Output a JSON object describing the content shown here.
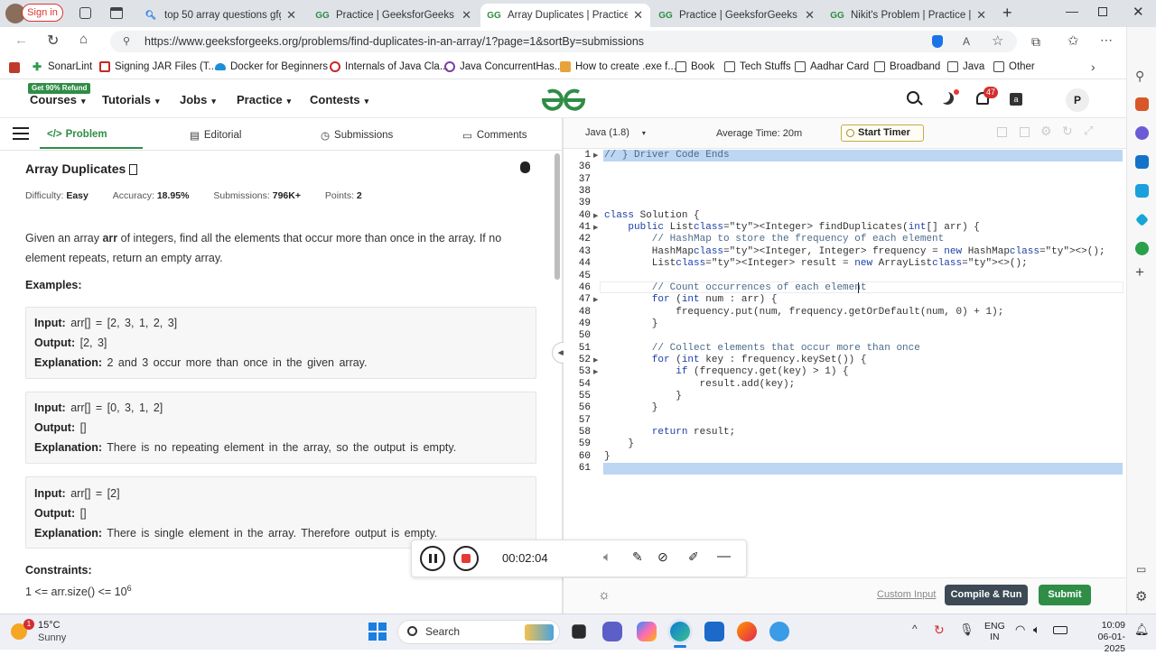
{
  "browser": {
    "profile_button": "Sign in",
    "tabs": [
      {
        "title": "top 50 array questions gfg - Se",
        "active": false
      },
      {
        "title": "Practice | GeeksforGeeks | A co",
        "active": false
      },
      {
        "title": "Array Duplicates | Practice | Ge",
        "active": true
      },
      {
        "title": "Practice | GeeksforGeeks | A co",
        "active": false
      },
      {
        "title": "Nikit's Problem | Practice | Gee",
        "active": false
      }
    ],
    "url": "https://www.geeksforgeeks.org/problems/find-duplicates-in-an-array/1?page=1&sortBy=submissions",
    "bookmarks": [
      "SonarLint",
      "Signing JAR Files (T...",
      "Docker for Beginners",
      "Internals of Java Cla...",
      "Java ConcurrentHas...",
      "How to create .exe f...",
      "Book",
      "Tech Stuffs",
      "Aadhar Card",
      "Broadband",
      "Java",
      "Other"
    ]
  },
  "header": {
    "refund_badge": "Get 90% Refund",
    "nav": [
      "Courses",
      "Tutorials",
      "Jobs",
      "Practice",
      "Contests"
    ],
    "notification_count": "47",
    "avatar_letter": "P"
  },
  "problem_tabs": [
    "Problem",
    "Editorial",
    "Submissions",
    "Comments"
  ],
  "problem": {
    "title": "Array Duplicates",
    "difficulty_label": "Difficulty:",
    "difficulty": "Easy",
    "accuracy_label": "Accuracy:",
    "accuracy": "18.95%",
    "submissions_label": "Submissions:",
    "submissions": "796K+",
    "points_label": "Points:",
    "points": "2",
    "desc_1a": "Given an array ",
    "desc_1b": "arr",
    "desc_1c": " of integers, find all the elements that occur more than once in the array. If no",
    "desc_2": "element repeats, return an empty array.",
    "examples_heading": "Examples:",
    "examples": [
      {
        "input": "arr[] = [2, 3, 1, 2, 3]",
        "output": "[2, 3]",
        "explanation": "2 and 3 occur more than once in the given array."
      },
      {
        "input": "arr[] = [0, 3, 1, 2]",
        "output": "[]",
        "explanation": "There is no repeating element in the array, so the output is empty."
      },
      {
        "input": "arr[] = [2]",
        "output": "[]",
        "explanation": "There is single element in the array. Therefore output is empty."
      }
    ],
    "input_label": "Input:",
    "output_label": "Output:",
    "explanation_label": "Explanation:",
    "constraints_heading": "Constraints:",
    "constraint_1": "1 <= arr.size() <= 10",
    "constraint_1_exp": "6"
  },
  "editor": {
    "language": "Java (1.8)",
    "avg_time": "Average Time: 20m",
    "timer_button": "Start Timer",
    "lines": [
      {
        "n": "1",
        "text": "// } Driver Code Ends"
      },
      {
        "n": "36",
        "text": ""
      },
      {
        "n": "37",
        "text": ""
      },
      {
        "n": "38",
        "text": ""
      },
      {
        "n": "39",
        "text": ""
      },
      {
        "n": "40",
        "text": "class Solution {"
      },
      {
        "n": "41",
        "text": "    public List<Integer> findDuplicates(int[] arr) {"
      },
      {
        "n": "42",
        "text": "        // HashMap to store the frequency of each element"
      },
      {
        "n": "43",
        "text": "        HashMap<Integer, Integer> frequency = new HashMap<>();"
      },
      {
        "n": "44",
        "text": "        List<Integer> result = new ArrayList<>();"
      },
      {
        "n": "45",
        "text": ""
      },
      {
        "n": "46",
        "text": "        // Count occurrences of each element"
      },
      {
        "n": "47",
        "text": "        for (int num : arr) {"
      },
      {
        "n": "48",
        "text": "            frequency.put(num, frequency.getOrDefault(num, 0) + 1);"
      },
      {
        "n": "49",
        "text": "        }"
      },
      {
        "n": "50",
        "text": ""
      },
      {
        "n": "51",
        "text": "        // Collect elements that occur more than once"
      },
      {
        "n": "52",
        "text": "        for (int key : frequency.keySet()) {"
      },
      {
        "n": "53",
        "text": "            if (frequency.get(key) > 1) {"
      },
      {
        "n": "54",
        "text": "                result.add(key);"
      },
      {
        "n": "55",
        "text": "            }"
      },
      {
        "n": "56",
        "text": "        }"
      },
      {
        "n": "57",
        "text": ""
      },
      {
        "n": "58",
        "text": "        return result;"
      },
      {
        "n": "59",
        "text": "    }"
      },
      {
        "n": "60",
        "text": "}"
      },
      {
        "n": "61",
        "text": ""
      }
    ],
    "custom_input": "Custom Input",
    "compile_button": "Compile & Run",
    "submit_button": "Submit"
  },
  "recorder": {
    "time": "00:02:04"
  },
  "taskbar": {
    "weather_temp": "15°C",
    "weather_desc": "Sunny",
    "weather_badge": "1",
    "search_label": "Search",
    "lang_1": "ENG",
    "lang_2": "IN",
    "time": "10:09",
    "date": "06-01-2025"
  },
  "colors": {
    "gfg_green": "#2f8d46",
    "dark_button": "#3d4a55",
    "selection": "#bcd6f3"
  }
}
